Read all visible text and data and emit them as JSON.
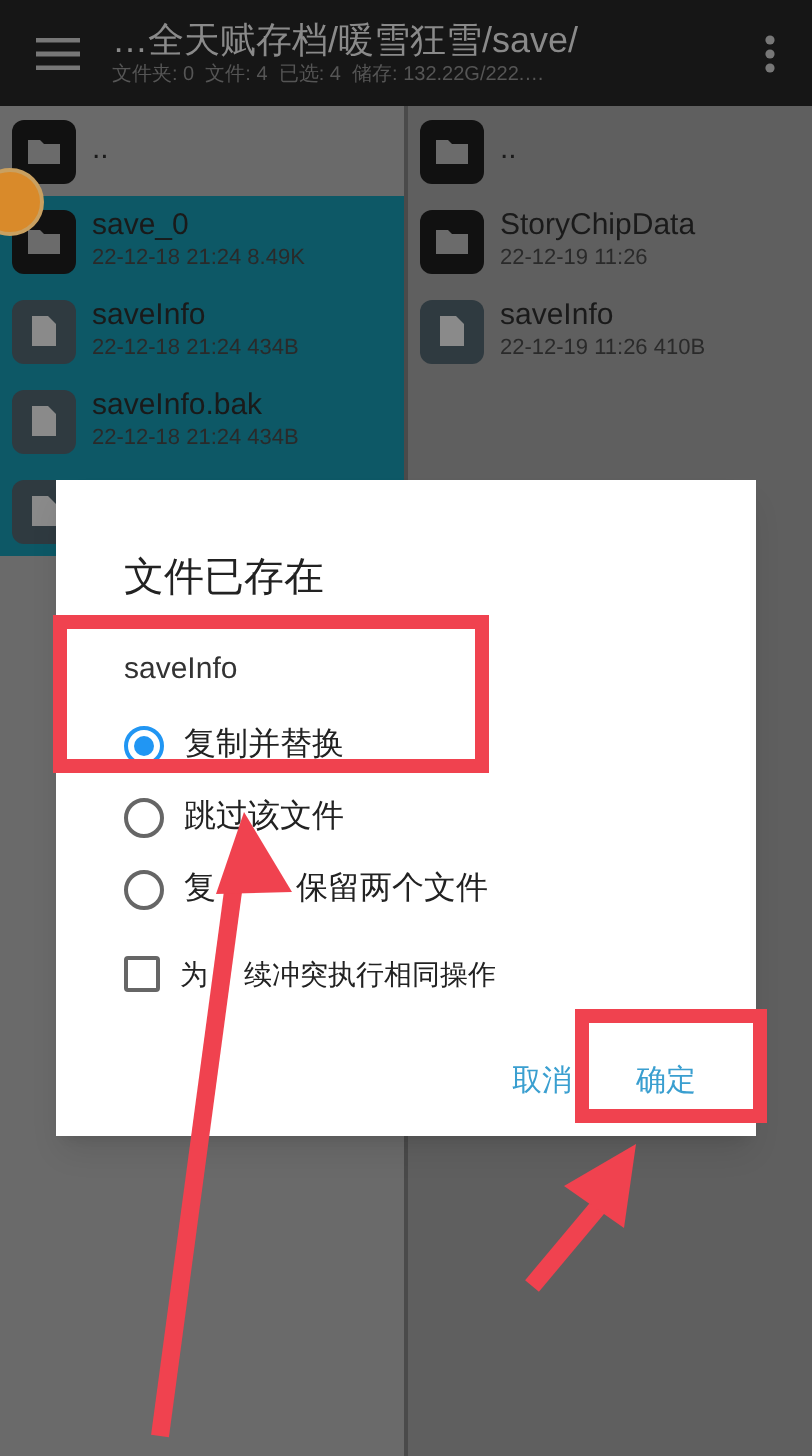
{
  "toolbar": {
    "title": "…全天赋存档/暖雪狂雪/save/",
    "subtitle": "文件夹: 0  文件: 4  已选: 4  储存: 132.22G/222.…"
  },
  "left_pane": {
    "items": [
      {
        "kind": "folder",
        "name": "..",
        "selected": false
      },
      {
        "kind": "folder",
        "name": "save_0",
        "meta": "22-12-18 21:24  8.49K",
        "selected": true
      },
      {
        "kind": "file",
        "name": "saveInfo",
        "meta": "22-12-18 21:24  434B",
        "selected": true
      },
      {
        "kind": "file",
        "name": "saveInfo.bak",
        "meta": "22-12-18 21:24  434B",
        "selected": true
      },
      {
        "kind": "file",
        "selected": true
      }
    ]
  },
  "right_pane": {
    "items": [
      {
        "kind": "folder",
        "name": "..",
        "selected": false
      },
      {
        "kind": "folder",
        "name": "StoryChipData",
        "meta": "22-12-19 11:26",
        "selected": false
      },
      {
        "kind": "file",
        "name": "saveInfo",
        "meta": "22-12-19 11:26  410B",
        "selected": false
      }
    ]
  },
  "dialog": {
    "title": "文件已存在",
    "file_name": "saveInfo",
    "options": [
      {
        "label_parts": [
          "复制并替换"
        ],
        "selected": true
      },
      {
        "label_parts": [
          "跳过该文件"
        ],
        "selected": false
      },
      {
        "label_parts": [
          "复",
          "保留两个文件"
        ],
        "selected": false
      }
    ],
    "apply_all": {
      "label_parts": [
        "为",
        "续冲突执行相同操作"
      ],
      "checked": false
    },
    "buttons": [
      "取消",
      "确定"
    ]
  }
}
